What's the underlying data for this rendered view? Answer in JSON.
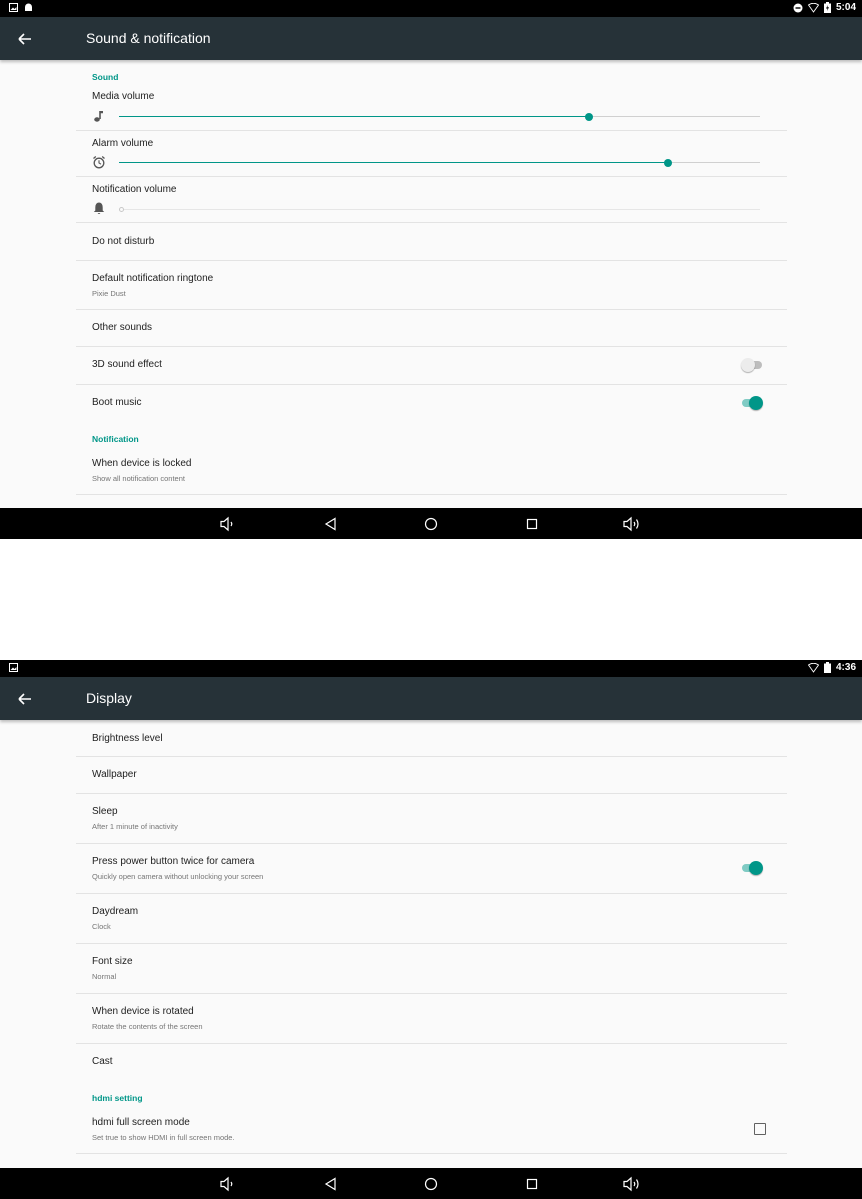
{
  "screen1": {
    "status": {
      "time": "5:04"
    },
    "appbar": {
      "title": "Sound & notification"
    },
    "sections": {
      "sound": "Sound",
      "notification": "Notification"
    },
    "media_volume": {
      "label": "Media volume",
      "level": 0.733
    },
    "alarm_volume": {
      "label": "Alarm volume",
      "level": 0.856
    },
    "notification_volume": {
      "label": "Notification volume",
      "level": 0.0
    },
    "do_not_disturb": {
      "label": "Do not disturb"
    },
    "ringtone": {
      "label": "Default notification ringtone",
      "value": "Pixie Dust"
    },
    "other_sounds": {
      "label": "Other sounds"
    },
    "sound_effect": {
      "label": "3D sound effect",
      "enabled": false
    },
    "boot_music": {
      "label": "Boot music",
      "enabled": true
    },
    "device_locked": {
      "label": "When device is locked",
      "value": "Show all notification content"
    }
  },
  "screen2": {
    "status": {
      "time": "4:36"
    },
    "appbar": {
      "title": "Display"
    },
    "brightness": {
      "label": "Brightness level"
    },
    "wallpaper": {
      "label": "Wallpaper"
    },
    "sleep": {
      "label": "Sleep",
      "value": "After 1 minute of inactivity"
    },
    "power_camera": {
      "label": "Press power button twice for camera",
      "value": "Quickly open camera without unlocking your screen",
      "enabled": true
    },
    "daydream": {
      "label": "Daydream",
      "value": "Clock"
    },
    "font_size": {
      "label": "Font size",
      "value": "Normal"
    },
    "rotation": {
      "label": "When device is rotated",
      "value": "Rotate the contents of the screen"
    },
    "cast": {
      "label": "Cast"
    },
    "hdmi_section": "hdmi setting",
    "hdmi_full": {
      "label": "hdmi full screen mode",
      "value": "Set true to show HDMI in full screen mode.",
      "checked": false
    }
  },
  "colors": {
    "accent": "#009688",
    "appbar": "#263238",
    "background": "#fafafa"
  },
  "icons": [
    "picture-icon",
    "android-icon",
    "dnd-icon",
    "wifi-icon",
    "battery-icon",
    "back-arrow-icon",
    "music-note-icon",
    "alarm-clock-icon",
    "bell-icon",
    "volume-down-icon",
    "nav-back-icon",
    "home-icon",
    "recents-icon",
    "volume-up-icon"
  ]
}
